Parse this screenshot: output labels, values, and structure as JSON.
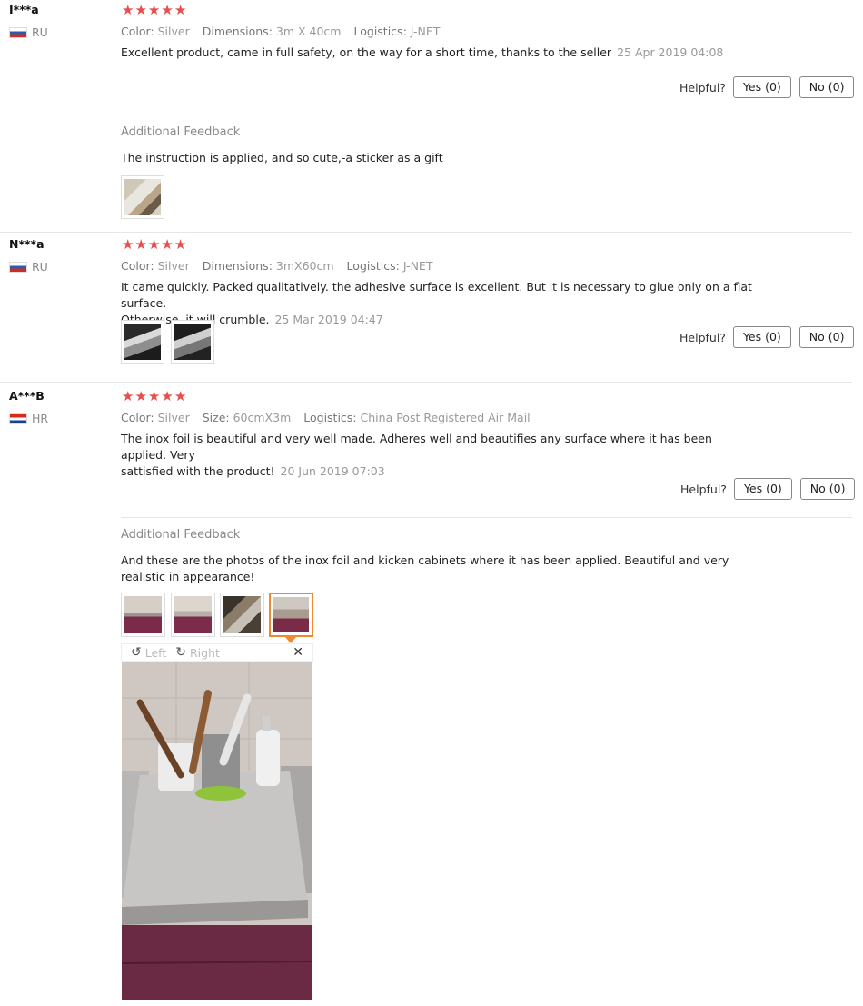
{
  "reviews": [
    {
      "user": "I***a",
      "country": "RU",
      "meta": {
        "color_label": "Color:",
        "color": "Silver",
        "dim_label": "Dimensions:",
        "dim": "3m X 40cm",
        "log_label": "Logistics:",
        "log": "J-NET"
      },
      "text": "Excellent product, came in full safety, on the way for a short time, thanks to the seller",
      "date": "25 Apr 2019 04:08",
      "helpful_label": "Helpful?",
      "yes": "Yes (0)",
      "no": "No (0)",
      "additional_title": "Additional Feedback",
      "additional_text": "The instruction is applied, and so cute,-a sticker as a gift"
    },
    {
      "user": "N***a",
      "country": "RU",
      "meta": {
        "color_label": "Color:",
        "color": "Silver",
        "dim_label": "Dimensions:",
        "dim": "3mX60cm",
        "log_label": "Logistics:",
        "log": "J-NET"
      },
      "text_line1": "It came quickly. Packed qualitatively. the adhesive surface is excellent. But it is necessary to glue only on a flat surface.",
      "text_line2": "Otherwise, it will crumble.",
      "date": "25 Mar 2019 04:47",
      "helpful_label": "Helpful?",
      "yes": "Yes (0)",
      "no": "No (0)"
    },
    {
      "user": "A***B",
      "country": "HR",
      "meta": {
        "color_label": "Color:",
        "color": "Silver",
        "dim_label": "Size:",
        "dim": "60cmX3m",
        "log_label": "Logistics:",
        "log": "China Post Registered Air Mail"
      },
      "text_line1": "The inox foil is beautiful and very well made. Adheres well and beautifies any surface where it has been applied. Very",
      "text_line2": "sattisfied with the product!",
      "date": "20 Jun 2019 07:03",
      "helpful_label": "Helpful?",
      "yes": "Yes (0)",
      "no": "No (0)",
      "additional_title": "Additional Feedback",
      "additional_text_line1": "And these are the photos of the inox foil and kicken cabinets where it has been applied. Beautiful and very",
      "additional_text_line2": "realistic in appearance!"
    }
  ],
  "viewer": {
    "left": "Left",
    "right": "Right"
  },
  "star_color": "#e84e4e",
  "active_thumb_color": "#f08a2f"
}
